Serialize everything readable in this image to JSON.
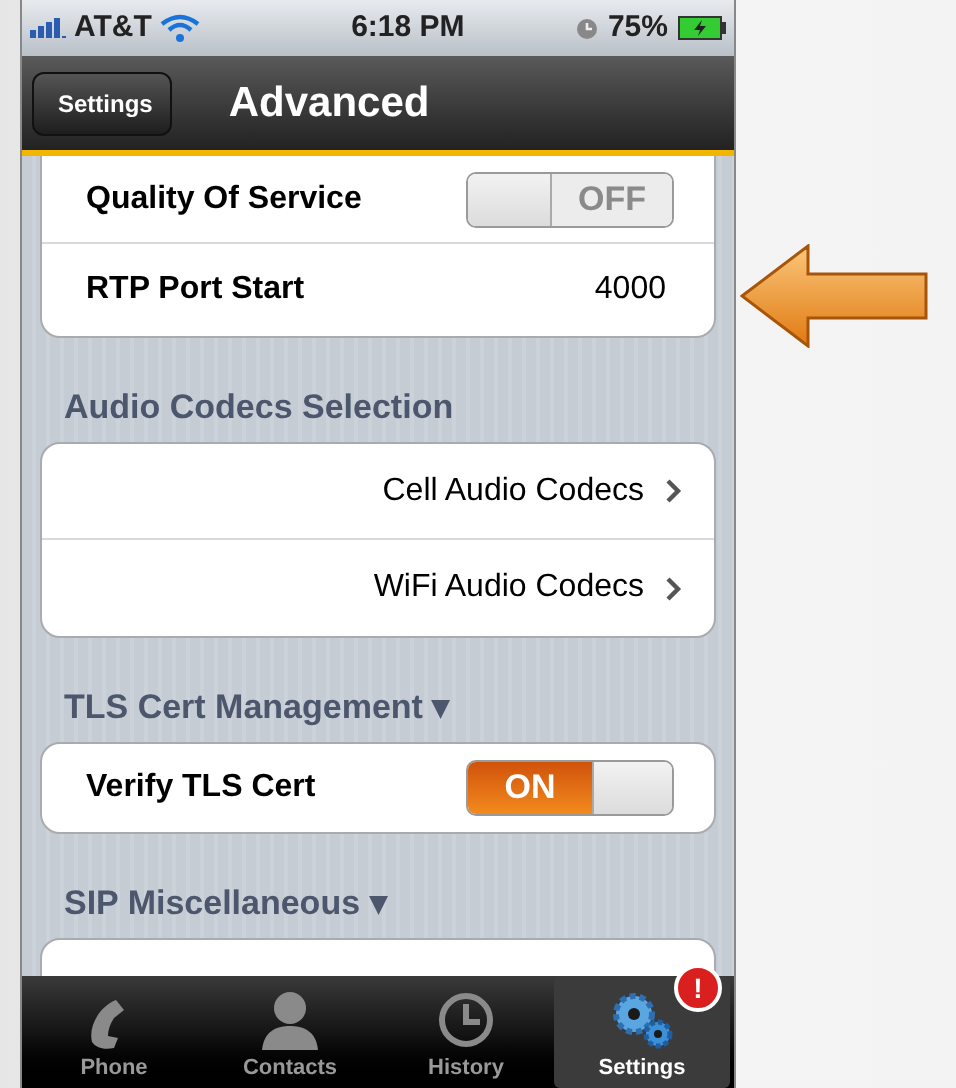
{
  "status_bar": {
    "carrier": "AT&T",
    "time": "6:18 PM",
    "battery": "75%"
  },
  "nav_bar": {
    "back": "Settings",
    "title": "Advanced"
  },
  "sections": [
    {
      "rows": [
        {
          "kind": "toggle",
          "label": "Quality Of Service",
          "on": false,
          "switch_text": "OFF"
        },
        {
          "kind": "value",
          "label": "RTP Port Start",
          "value": "4000"
        }
      ]
    },
    {
      "header": "Audio Codecs Selection",
      "rows": [
        {
          "kind": "link",
          "label": "Cell Audio Codecs"
        },
        {
          "kind": "link",
          "label": "WiFi Audio Codecs"
        }
      ]
    },
    {
      "header": "TLS Cert Management ▾",
      "rows": [
        {
          "kind": "toggle",
          "label": "Verify TLS Cert",
          "on": true,
          "switch_text": "ON"
        }
      ]
    },
    {
      "header": "SIP Miscellaneous ▾"
    }
  ],
  "tab_bar": [
    {
      "label": "Phone",
      "selected": false
    },
    {
      "label": "Contacts",
      "selected": false
    },
    {
      "label": "History",
      "selected": false
    },
    {
      "label": "Settings",
      "selected": true,
      "badge": "!"
    }
  ]
}
